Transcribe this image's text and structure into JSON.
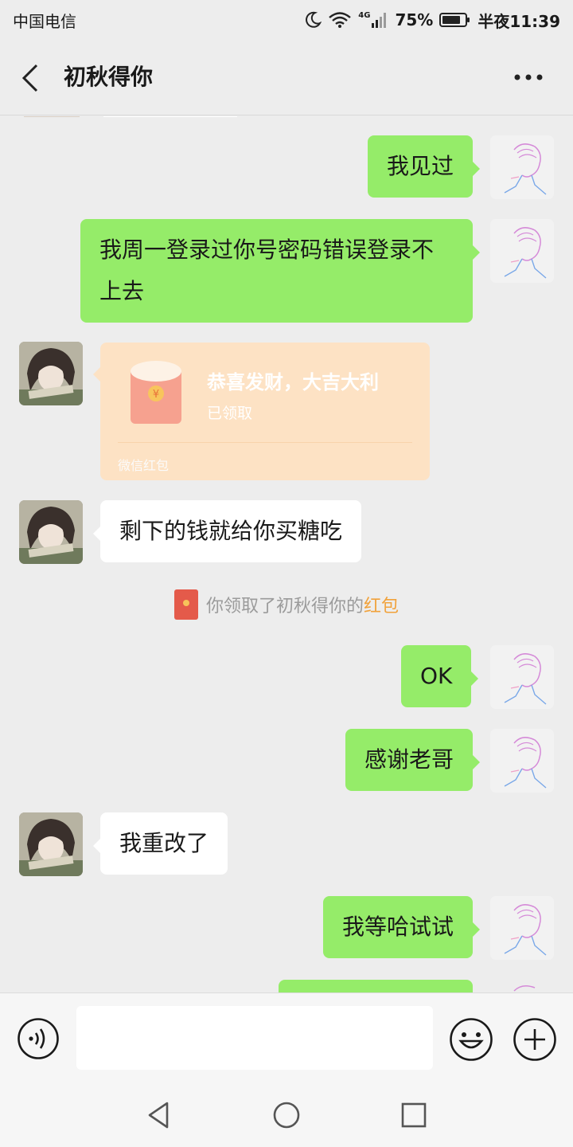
{
  "status_bar": {
    "carrier": "中国电信",
    "network": "4G",
    "battery": "75%",
    "time": "半夜11:39",
    "icons": [
      "moon-icon",
      "wifi-icon",
      "signal-icon",
      "battery-icon"
    ]
  },
  "header": {
    "title": "初秋得你",
    "back_icon": "chevron-left-icon",
    "more_icon": "more-dots-icon"
  },
  "messages": [
    {
      "sender": "me",
      "type": "text",
      "text": "我见过"
    },
    {
      "sender": "me",
      "type": "text",
      "text": "我周一登录过你号密码错误登录不上去"
    },
    {
      "sender": "friend",
      "type": "red_packet",
      "title": "恭喜发财，大吉大利",
      "status": "已领取",
      "footer": "微信红包"
    },
    {
      "sender": "friend",
      "type": "text",
      "text": "剩下的钱就给你买糖吃"
    },
    {
      "sender": "system",
      "type": "notice",
      "text": "你领取了初秋得你的",
      "highlight": "红包"
    },
    {
      "sender": "me",
      "type": "text",
      "text": "OK"
    },
    {
      "sender": "me",
      "type": "text",
      "text": "感谢老哥"
    },
    {
      "sender": "friend",
      "type": "text",
      "text": "我重改了"
    },
    {
      "sender": "me",
      "type": "text",
      "text": "我等哈试试"
    }
  ],
  "input_bar": {
    "placeholder": "",
    "value": "",
    "icons": [
      "voice-icon",
      "emoji-icon",
      "plus-icon"
    ]
  },
  "nav_bar": {
    "icons": [
      "nav-back-icon",
      "nav-home-icon",
      "nav-recent-icon"
    ]
  },
  "colors": {
    "background": "#ededed",
    "outgoing_bubble": "#95ec69",
    "incoming_bubble": "#ffffff",
    "red_packet_card": "#fde2c4",
    "highlight_text": "#f1a23b"
  }
}
